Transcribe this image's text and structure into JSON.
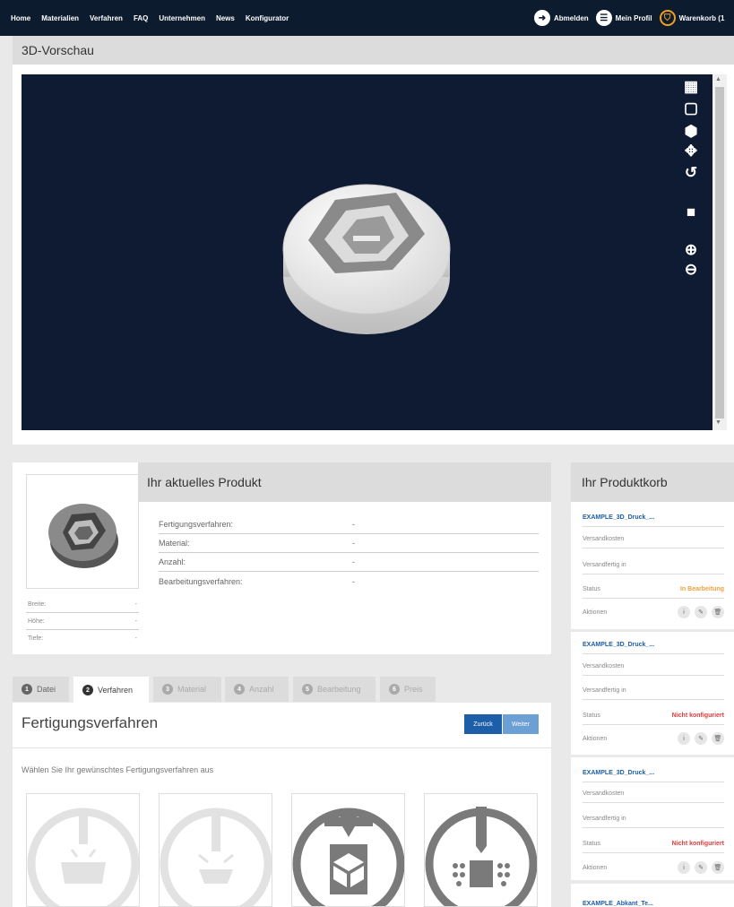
{
  "nav": {
    "items": [
      "Home",
      "Materialien",
      "Verfahren",
      "FAQ",
      "Unternehmen",
      "News",
      "Konfigurator"
    ],
    "logout": "Abmelden",
    "profile": "Mein Profil",
    "cart": "Warenkorb (1"
  },
  "preview": {
    "title": "3D-Vorschau"
  },
  "product": {
    "title": "Ihr aktuelles Produkt",
    "rows": [
      {
        "label": "Fertigungsverfahren:",
        "value": "-"
      },
      {
        "label": "Material:",
        "value": "-"
      },
      {
        "label": "Anzahl:",
        "value": "-"
      },
      {
        "label": "Bearbeitungsverfahren:",
        "value": "-"
      }
    ],
    "dims": [
      {
        "label": "Breite:",
        "value": "-"
      },
      {
        "label": "Höhe:",
        "value": "-"
      },
      {
        "label": "Tiefe:",
        "value": "-"
      }
    ]
  },
  "tabs": [
    {
      "num": "1",
      "label": "Datei"
    },
    {
      "num": "2",
      "label": "Verfahren"
    },
    {
      "num": "3",
      "label": "Material"
    },
    {
      "num": "4",
      "label": "Anzahl"
    },
    {
      "num": "5",
      "label": "Bearbeitung"
    },
    {
      "num": "6",
      "label": "Preis"
    }
  ],
  "process": {
    "title": "Fertigungsverfahren",
    "back": "Zurück",
    "next": "Weiter",
    "hint": "Wählen Sie Ihr gewünschtes Fertigungsverfahren aus"
  },
  "cart": {
    "title": "Ihr Produktkorb",
    "items": [
      {
        "name": "EXAMPLE_3D_Druck_...",
        "shipping": "Versandkosten",
        "ready": "Versandfertig in",
        "status_label": "Status",
        "status": "In Bearbeitung",
        "status_color": "#f0a040",
        "actions": "Aktionen"
      },
      {
        "name": "EXAMPLE_3D_Druck_...",
        "shipping": "Versandkosten",
        "ready": "Versandfertig in",
        "status_label": "Status",
        "status": "Nicht konfiguriert",
        "status_color": "#e03c3c",
        "actions": "Aktionen"
      },
      {
        "name": "EXAMPLE_3D_Druck_...",
        "shipping": "Versandkosten",
        "ready": "Versandfertig in",
        "status_label": "Status",
        "status": "Nicht konfiguriert",
        "status_color": "#e03c3c",
        "actions": "Aktionen"
      }
    ],
    "last": "EXAMPLE_Abkant_Te..."
  },
  "colors": {
    "accent_blue": "#1c5fa8",
    "nav_bg": "#0d1b2e",
    "viewer_bg": "#0f1b33"
  }
}
